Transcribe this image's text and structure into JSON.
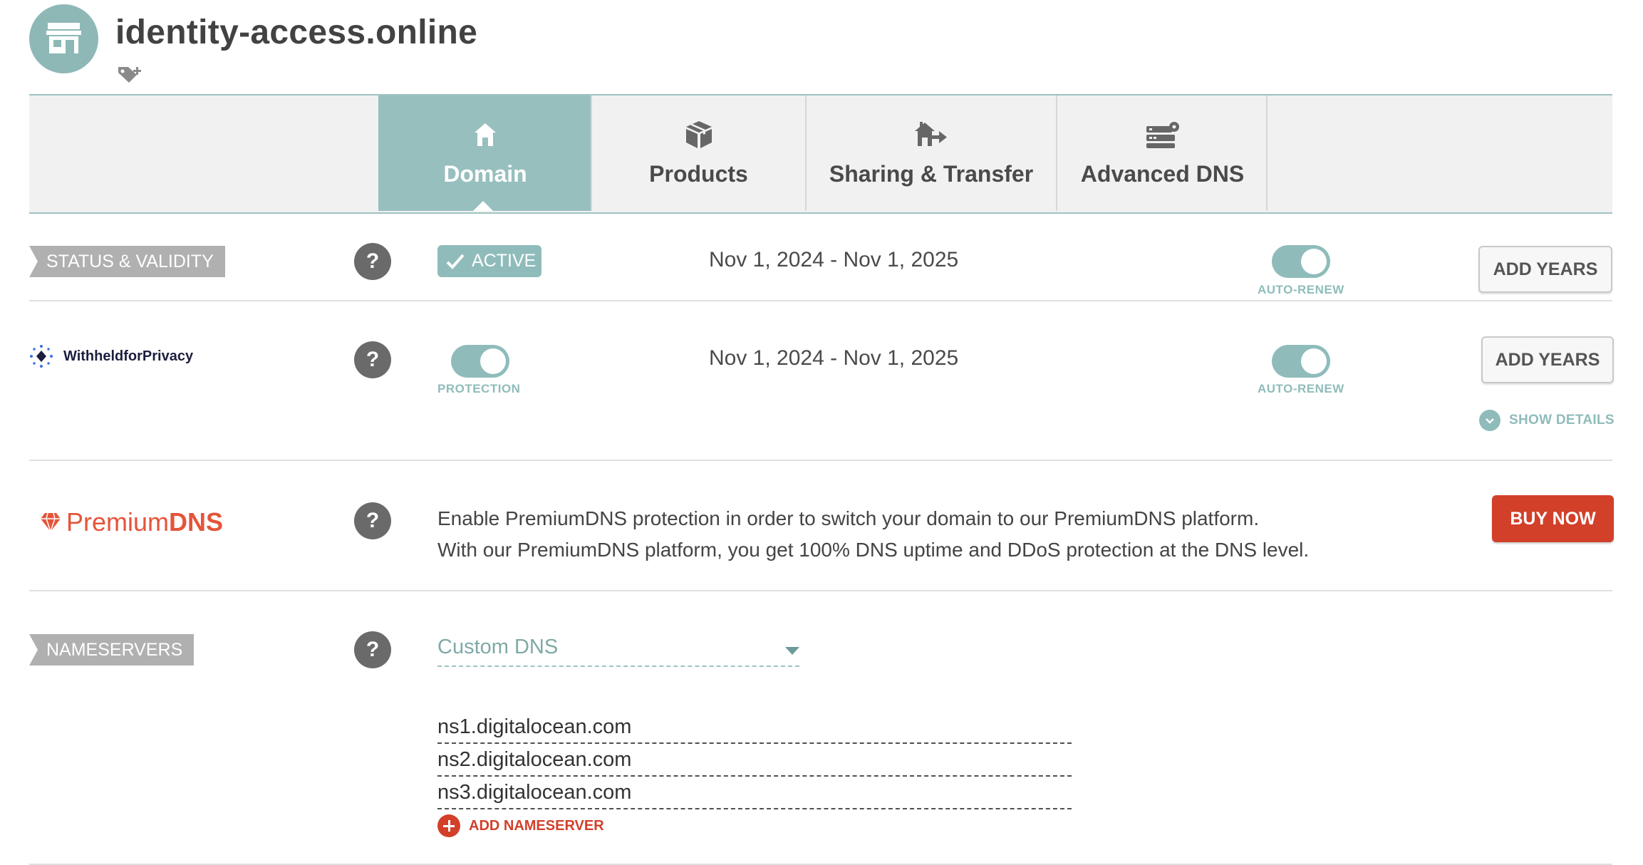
{
  "header": {
    "domain_name": "identity-access.online",
    "avatar_icon": "storefront-icon",
    "tag_icon": "add-tag-icon"
  },
  "tabs": [
    {
      "label": "Domain",
      "icon": "home-icon",
      "active": true
    },
    {
      "label": "Products",
      "icon": "box-icon",
      "active": false
    },
    {
      "label": "Sharing & Transfer",
      "icon": "house-arrow-icon",
      "active": false
    },
    {
      "label": "Advanced DNS",
      "icon": "server-gear-icon",
      "active": false
    }
  ],
  "status": {
    "section_label": "STATUS & VALIDITY",
    "badge": "ACTIVE",
    "date_range": "Nov 1, 2024 - Nov 1, 2025",
    "autorenew_label": "AUTO-RENEW",
    "autorenew_on": true,
    "add_years": "ADD YEARS"
  },
  "privacy": {
    "logo_text": "WithheldforPrivacy",
    "protection_label": "PROTECTION",
    "protection_on": true,
    "date_range": "Nov 1, 2024 - Nov 1, 2025",
    "autorenew_label": "AUTO-RENEW",
    "autorenew_on": true,
    "add_years": "ADD YEARS",
    "show_details": "SHOW DETAILS"
  },
  "premiumdns": {
    "logo_light": "Premium",
    "logo_bold": "DNS",
    "description_line1": "Enable PremiumDNS protection in order to switch your domain to our PremiumDNS platform.",
    "description_line2": "With our PremiumDNS platform, you get 100% DNS uptime and DDoS protection at the DNS level.",
    "buy_now": "BUY NOW"
  },
  "nameservers": {
    "section_label": "NAMESERVERS",
    "selected_type": "Custom DNS",
    "servers": [
      "ns1.digitalocean.com",
      "ns2.digitalocean.com",
      "ns3.digitalocean.com"
    ],
    "add_label": "ADD NAMESERVER"
  },
  "colors": {
    "accent_teal": "#97bfbe",
    "danger_red": "#d2402a",
    "premium_orange": "#e5543a",
    "label_gray": "#b0b0b0"
  }
}
